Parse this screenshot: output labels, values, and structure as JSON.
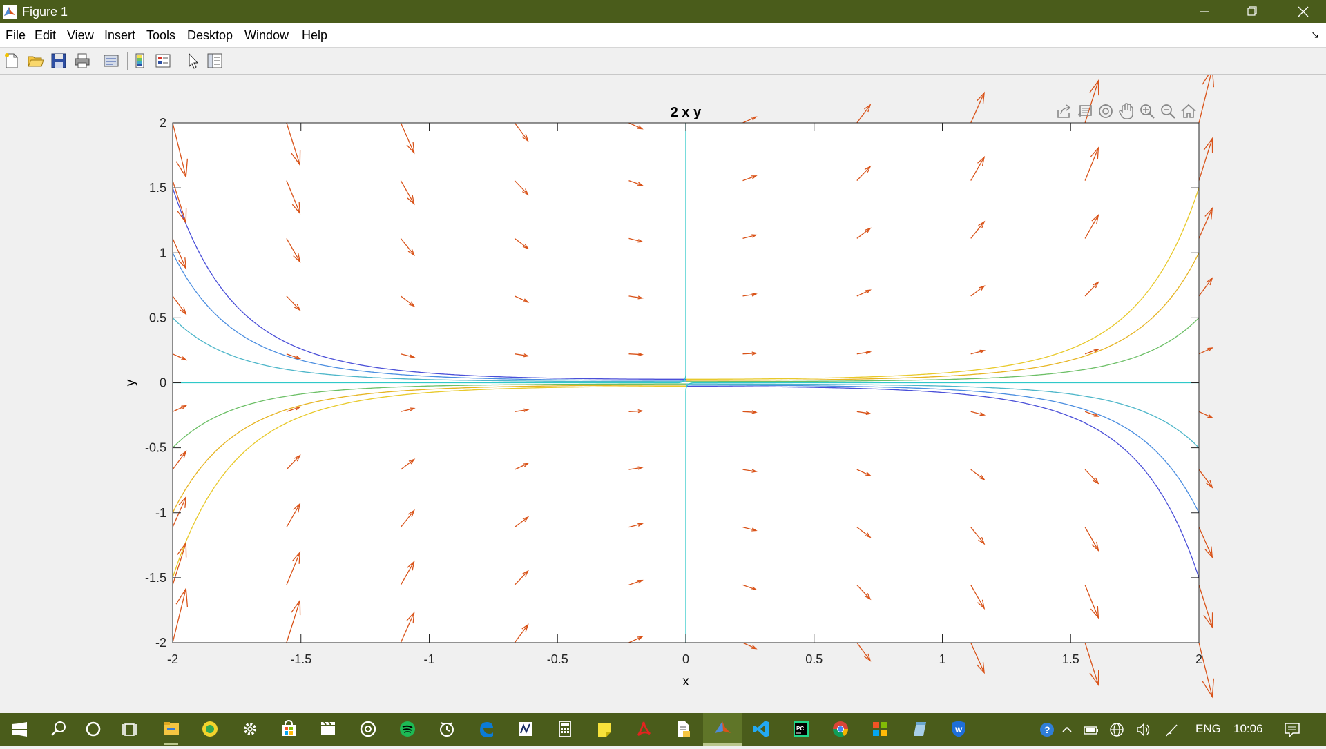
{
  "window": {
    "title": "Figure 1"
  },
  "menu": [
    "File",
    "Edit",
    "View",
    "Insert",
    "Tools",
    "Desktop",
    "Window",
    "Help"
  ],
  "toolbar": {
    "icons": [
      "new-figure-icon",
      "open-file-icon",
      "save-icon",
      "print-icon",
      "link-plot-icon",
      "insert-colorbar-icon",
      "insert-legend-icon",
      "edit-plot-icon",
      "property-inspector-icon"
    ]
  },
  "axes_toolbar": {
    "icons": [
      "export-icon",
      "data-tips-icon",
      "rotate-3d-icon",
      "pan-icon",
      "zoom-in-icon",
      "zoom-out-icon",
      "home-icon"
    ]
  },
  "chart_data": {
    "type": "quiver",
    "title": "2 x y",
    "xlabel": "x",
    "ylabel": "y",
    "xlim": [
      -2,
      2
    ],
    "ylim": [
      -2,
      2
    ],
    "xticks": [
      "-2",
      "-1.5",
      "-1",
      "-0.5",
      "0",
      "0.5",
      "1",
      "1.5",
      "2"
    ],
    "yticks": [
      "2",
      "1.5",
      "1",
      "0.5",
      "0",
      "-0.5",
      "-1",
      "-1.5",
      "-2"
    ],
    "vector_field": {
      "dx": 1,
      "dy": "2xy",
      "grid_x": [
        -2,
        -1.556,
        -1.111,
        -0.667,
        -0.222,
        0.222,
        0.667,
        1.111,
        1.556,
        2
      ],
      "grid_y": [
        2,
        1.556,
        1.111,
        0.667,
        0.222,
        -0.222,
        -0.667,
        -1.111,
        -1.556,
        -2
      ],
      "color": "#d95319"
    },
    "contours": {
      "function": "y*exp(-x^2)",
      "levels": [
        -0.125,
        -0.0625,
        -0.03125,
        -0.015625,
        0,
        0.015625,
        0.03125,
        0.0625,
        0.125
      ]
    },
    "grid": false,
    "legend": "none"
  },
  "taskbar": {
    "icons": [
      "windows-start-icon",
      "search-icon",
      "cortana-icon",
      "task-view-icon",
      "file-explorer-icon",
      "app-icon",
      "settings-icon",
      "store-icon",
      "video-editor-icon",
      "media-player-icon",
      "spotify-icon",
      "clock-icon",
      "edge-icon",
      "notepad-icon",
      "calculator-icon",
      "sticky-notes-icon",
      "acrobat-icon",
      "document-icon",
      "matlab-icon",
      "vscode-icon",
      "pycharm-icon",
      "chrome-icon",
      "office-icon",
      "notes-icon",
      "vpn-icon"
    ],
    "tray": {
      "language": "ENG",
      "time": "10:06"
    }
  }
}
